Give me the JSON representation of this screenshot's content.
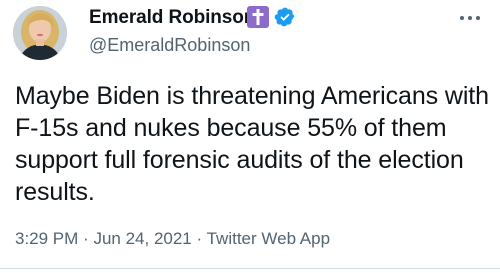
{
  "author": {
    "display_name": "Emerald Robinson",
    "handle": "@EmeraldRobinson"
  },
  "tweet": {
    "text": "Maybe Biden is threatening Americans with F-15s and nukes because 55% of them support full forensic audits of the election results.",
    "time": "3:29 PM",
    "separator": "·",
    "date": "Jun 24, 2021",
    "source": "Twitter Web App"
  },
  "icons": {
    "cross_badge": "cross-icon",
    "verified": "verified-badge-icon",
    "more": "more-options-icon"
  },
  "colors": {
    "text_primary": "#0f1419",
    "text_secondary": "#536471",
    "verified_blue": "#1d9bf0",
    "cross_badge_purple": "#8e6bc9"
  }
}
